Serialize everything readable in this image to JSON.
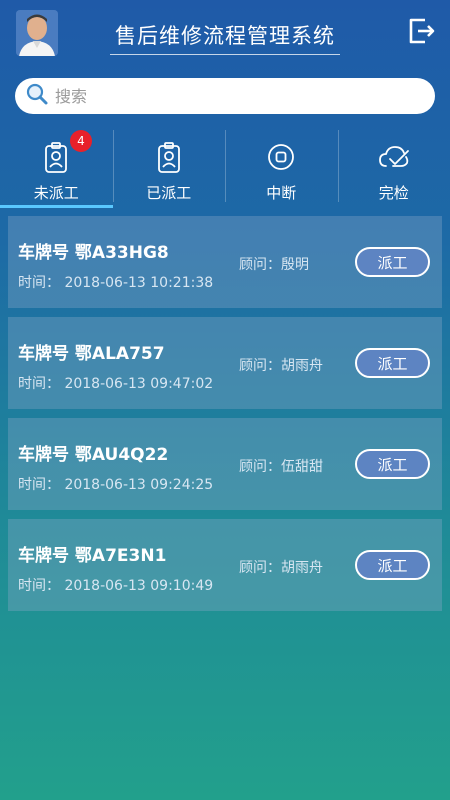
{
  "header": {
    "title": "售后维修流程管理系统",
    "avatar_icon": "user-avatar",
    "logout_icon": "logout-icon"
  },
  "search": {
    "placeholder": "搜索",
    "value": ""
  },
  "tabs": [
    {
      "label": "未派工",
      "icon": "badge-person-icon",
      "badge": "4",
      "active": true
    },
    {
      "label": "已派工",
      "icon": "badge-person-icon",
      "active": false
    },
    {
      "label": "中断",
      "icon": "stop-circle-icon",
      "active": false
    },
    {
      "label": "完检",
      "icon": "cloud-check-icon",
      "active": false
    }
  ],
  "orders": [
    {
      "plate": "车牌号 鄂A33HG8",
      "time": "时间：  2018-06-13 10:21:38",
      "advisor": "顾问：殷明",
      "action": "派工"
    },
    {
      "plate": "车牌号 鄂ALA757",
      "time": "时间：  2018-06-13 09:47:02",
      "advisor": "顾问：胡雨舟",
      "action": "派工"
    },
    {
      "plate": "车牌号 鄂AU4Q22",
      "time": "时间：  2018-06-13 09:24:25",
      "advisor": "顾问：伍甜甜",
      "action": "派工"
    },
    {
      "plate": "车牌号 鄂A7E3N1",
      "time": "时间：  2018-06-13 09:10:49",
      "advisor": "顾问：胡雨舟",
      "action": "派工"
    }
  ],
  "colors": {
    "background_top": "#1f5aa8",
    "background_bottom": "#22a08c",
    "active_tab_indicator": "#5ac8ff",
    "badge": "#e8212a",
    "button_fill": "#5d84c2"
  }
}
